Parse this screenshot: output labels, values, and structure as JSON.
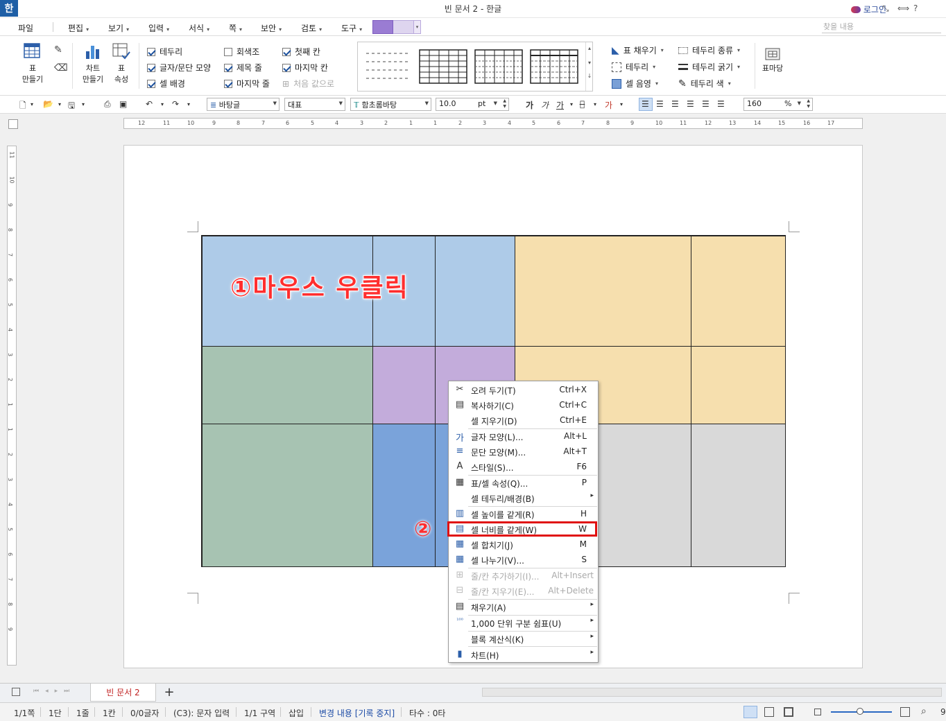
{
  "window": {
    "app_logo": "한",
    "title": "빈 문서 2 - 한글",
    "login_label": "로그인",
    "controls": [
      "⤡",
      "⟺",
      "?",
      "–",
      "□",
      "✕"
    ]
  },
  "menu": {
    "items": [
      "파일",
      "편집",
      "보기",
      "입력",
      "서식",
      "쪽",
      "보안",
      "검토",
      "도구"
    ],
    "find_placeholder": "찾을 내용"
  },
  "ribbon": {
    "table_make": "표\n만들기",
    "chart_make": "차트\n만들기",
    "table_props": "표\n속성",
    "checks": [
      {
        "label": "테두리",
        "checked": true
      },
      {
        "label": "글자/문단 모양",
        "checked": true
      },
      {
        "label": "셀 배경",
        "checked": true
      },
      {
        "label": "회색조",
        "checked": false
      },
      {
        "label": "제목 줄",
        "checked": true
      },
      {
        "label": "마지막 줄",
        "checked": true
      },
      {
        "label": "첫째 칸",
        "checked": true
      },
      {
        "label": "마지막 칸",
        "checked": true
      },
      {
        "label": "처음 값으로",
        "checked": false,
        "disabled": true
      }
    ],
    "side": [
      "표 채우기",
      "테두리",
      "셀 음영",
      "테두리 종류",
      "테두리 굵기",
      "테두리 색"
    ],
    "marquee": "표마당"
  },
  "toolbar": {
    "style": "바탕글",
    "lang": "대표",
    "font": "함초롬바탕",
    "size": "10.0",
    "unit": "pt",
    "char_btns": [
      "가",
      "가",
      "가"
    ],
    "zoom": "160",
    "zoom_unit": "%"
  },
  "ruler": {
    "h_labels": [
      "12",
      "11",
      "10",
      "9",
      "8",
      "7",
      "6",
      "5",
      "4",
      "3",
      "2",
      "1",
      "1",
      "2",
      "3",
      "4",
      "5",
      "6",
      "7",
      "8",
      "9",
      "10",
      "11",
      "12",
      "13",
      "14",
      "15",
      "16",
      "17"
    ],
    "v_labels": [
      "11",
      "10",
      "9",
      "8",
      "7",
      "6",
      "5",
      "4",
      "3",
      "2",
      "1",
      "1",
      "2",
      "3",
      "4",
      "5",
      "6",
      "7",
      "8",
      "9"
    ]
  },
  "document": {
    "annotation_1": "①마우스 우클릭",
    "annotation_2": "②"
  },
  "context_menu": {
    "items": [
      {
        "icon": "✂",
        "label": "오려 두기(T)",
        "shortcut": "Ctrl+X"
      },
      {
        "icon": "▤",
        "label": "복사하기(C)",
        "shortcut": "Ctrl+C"
      },
      {
        "icon": "",
        "label": "셀 지우기(D)",
        "shortcut": "Ctrl+E"
      },
      {
        "icon": "가",
        "label": "글자 모양(L)...",
        "shortcut": "Alt+L"
      },
      {
        "icon": "≡",
        "label": "문단 모양(M)...",
        "shortcut": "Alt+T"
      },
      {
        "icon": "A",
        "label": "스타일(S)...",
        "shortcut": "F6"
      },
      {
        "icon": "▦",
        "label": "표/셀 속성(Q)...",
        "shortcut": "P"
      },
      {
        "icon": "",
        "label": "셀 테두리/배경(B)",
        "shortcut": ""
      },
      {
        "icon": "▥",
        "label": "셀 높이를 같게(R)",
        "shortcut": "H"
      },
      {
        "icon": "▤",
        "label": "셀 너비를 같게(W)",
        "shortcut": "W"
      },
      {
        "icon": "▦",
        "label": "셀 합치기(J)",
        "shortcut": "M"
      },
      {
        "icon": "▦",
        "label": "셀 나누기(V)...",
        "shortcut": "S"
      },
      {
        "icon": "⊞",
        "label": "줄/칸 추가하기(I)...",
        "shortcut": "Alt+Insert"
      },
      {
        "icon": "⊟",
        "label": "줄/칸 지우기(E)...",
        "shortcut": "Alt+Delete"
      },
      {
        "icon": "▤",
        "label": "채우기(A)",
        "shortcut": ""
      },
      {
        "icon": "¹⁰⁰",
        "label": "1,000 단위 구분 쉼표(U)",
        "shortcut": ""
      },
      {
        "icon": "",
        "label": "블록 계산식(K)",
        "shortcut": ""
      },
      {
        "icon": "▮",
        "label": "차트(H)",
        "shortcut": ""
      }
    ]
  },
  "tabs": {
    "doc_tab": "빈 문서 2",
    "add": "+"
  },
  "status": {
    "page": "1/1쪽",
    "col": "1단",
    "line": "1줄",
    "cell": "1칸",
    "chars": "0/0글자",
    "cell_pos": "(C3): 문자 입력",
    "section": "1/1 구역",
    "insert": "삽입",
    "track": "변경 내용 [기록 중지]",
    "typing": "타수 : 0타",
    "zoom_tail": "9"
  }
}
